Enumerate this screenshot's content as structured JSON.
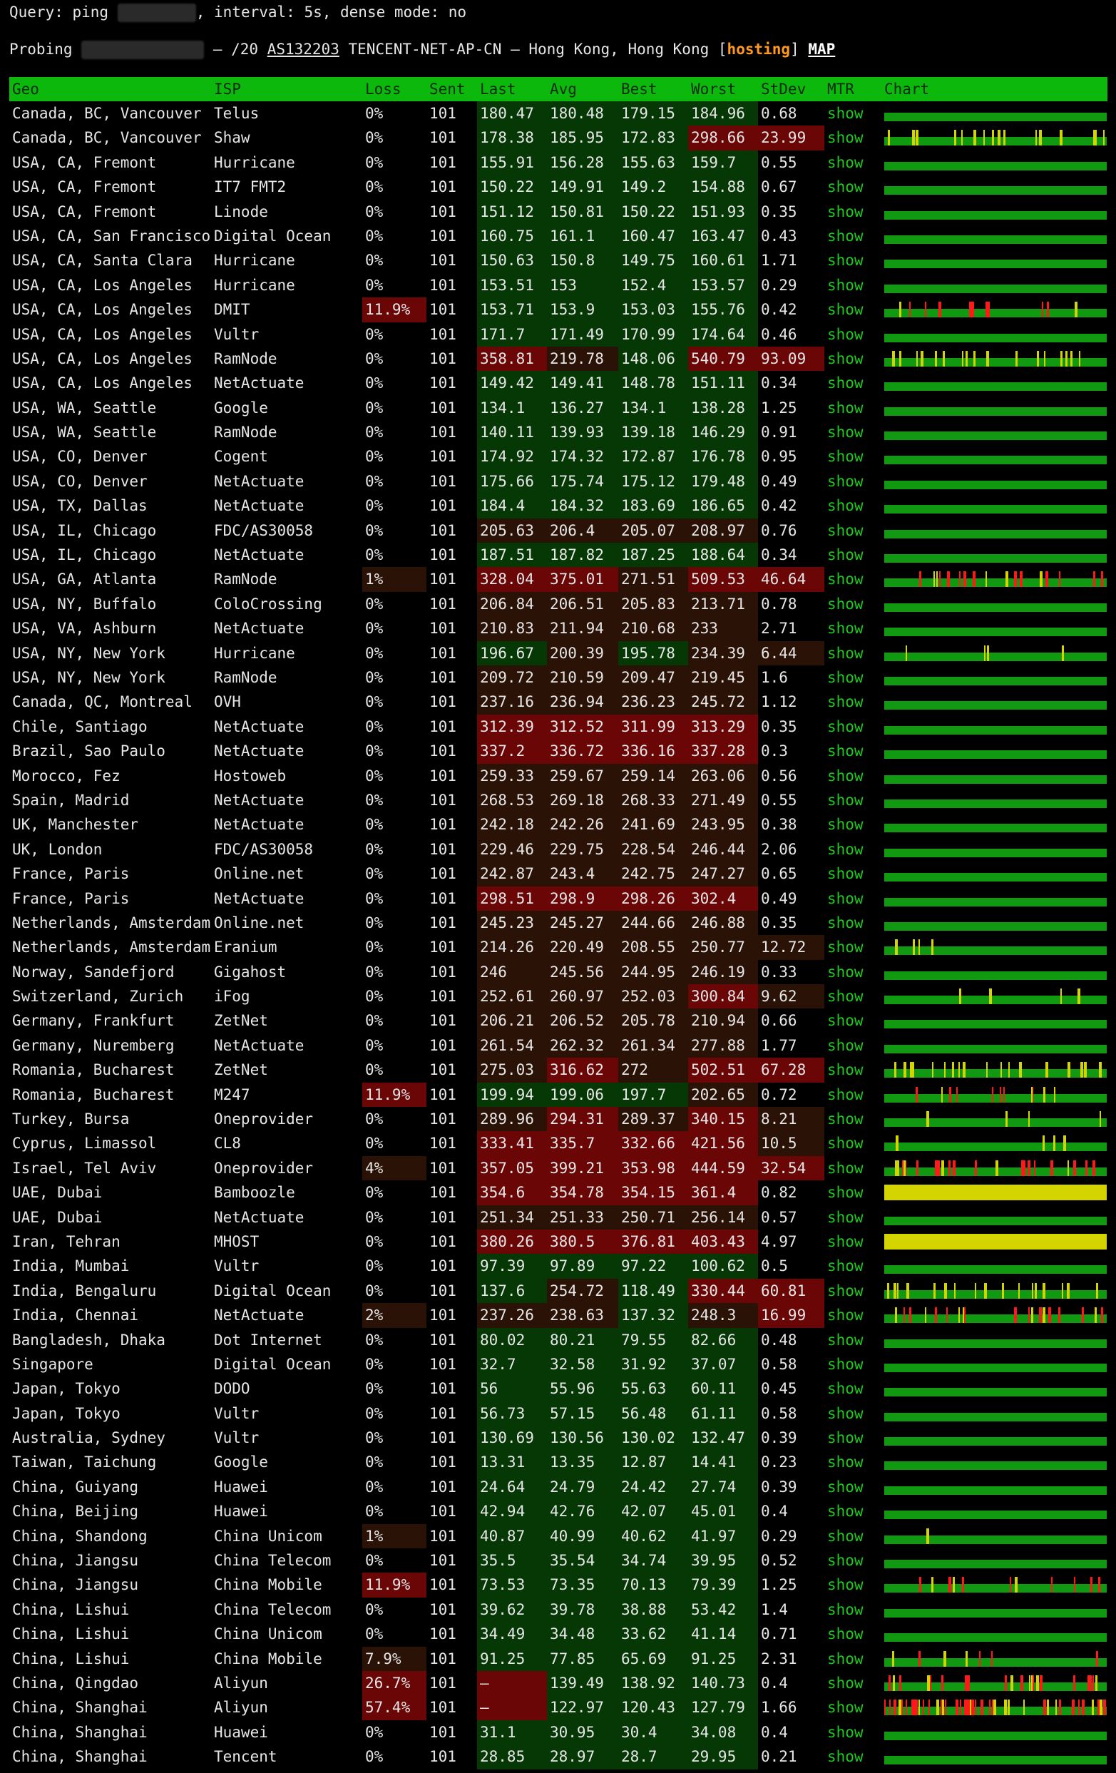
{
  "header": {
    "query_prefix": "Query: ping",
    "query_suffix": ", interval: 5s, dense mode: no",
    "probing_label": "Probing",
    "prefix": "– /20",
    "asn": "AS132203",
    "as_name": "TENCENT-NET-AP-CN – Hong Kong, Hong Kong",
    "tag": "hosting",
    "map_link": "MAP"
  },
  "columns": [
    "Geo",
    "ISP",
    "Loss",
    "Sent",
    "Last",
    "Avg",
    "Best",
    "Worst",
    "StDev",
    "MTR",
    "Chart"
  ],
  "mtr_label": "show",
  "colors": {
    "header_bg": "#0bb80b",
    "good": "#063806",
    "warn": "#2a1206",
    "bad": "#6a0606",
    "chart_base": "#119a11",
    "chart_spike_red": "#ff1a1a",
    "chart_spike_yellow": "#d4d400"
  },
  "rows": [
    [
      "Canada, BC, Vancouver",
      "Telus",
      "0%",
      "101",
      "180.47",
      "180.48",
      "179.15",
      "184.96",
      "0.68"
    ],
    [
      "Canada, BC, Vancouver",
      "Shaw",
      "0%",
      "101",
      "178.38",
      "185.95",
      "172.83",
      "298.66",
      "23.99"
    ],
    [
      "USA, CA, Fremont",
      "Hurricane",
      "0%",
      "101",
      "155.91",
      "156.28",
      "155.63",
      "159.7",
      "0.55"
    ],
    [
      "USA, CA, Fremont",
      "IT7 FMT2",
      "0%",
      "101",
      "150.22",
      "149.91",
      "149.2",
      "154.88",
      "0.67"
    ],
    [
      "USA, CA, Fremont",
      "Linode",
      "0%",
      "101",
      "151.12",
      "150.81",
      "150.22",
      "151.93",
      "0.35"
    ],
    [
      "USA, CA, San Francisco",
      "Digital Ocean",
      "0%",
      "101",
      "160.75",
      "161.1",
      "160.47",
      "163.47",
      "0.43"
    ],
    [
      "USA, CA, Santa Clara",
      "Hurricane",
      "0%",
      "101",
      "150.63",
      "150.8",
      "149.75",
      "160.61",
      "1.71"
    ],
    [
      "USA, CA, Los Angeles",
      "Hurricane",
      "0%",
      "101",
      "153.51",
      "153",
      "152.4",
      "153.57",
      "0.29"
    ],
    [
      "USA, CA, Los Angeles",
      "DMIT",
      "11.9%",
      "101",
      "153.71",
      "153.9",
      "153.03",
      "155.76",
      "0.42"
    ],
    [
      "USA, CA, Los Angeles",
      "Vultr",
      "0%",
      "101",
      "171.7",
      "171.49",
      "170.99",
      "174.64",
      "0.46"
    ],
    [
      "USA, CA, Los Angeles",
      "RamNode",
      "0%",
      "101",
      "358.81",
      "219.78",
      "148.06",
      "540.79",
      "93.09"
    ],
    [
      "USA, CA, Los Angeles",
      "NetActuate",
      "0%",
      "101",
      "149.42",
      "149.41",
      "148.78",
      "151.11",
      "0.34"
    ],
    [
      "USA, WA, Seattle",
      "Google",
      "0%",
      "101",
      "134.1",
      "136.27",
      "134.1",
      "138.28",
      "1.25"
    ],
    [
      "USA, WA, Seattle",
      "RamNode",
      "0%",
      "101",
      "140.11",
      "139.93",
      "139.18",
      "146.29",
      "0.91"
    ],
    [
      "USA, CO, Denver",
      "Cogent",
      "0%",
      "101",
      "174.92",
      "174.32",
      "172.87",
      "176.78",
      "0.95"
    ],
    [
      "USA, CO, Denver",
      "NetActuate",
      "0%",
      "101",
      "175.66",
      "175.74",
      "175.12",
      "179.48",
      "0.49"
    ],
    [
      "USA, TX, Dallas",
      "NetActuate",
      "0%",
      "101",
      "184.4",
      "184.32",
      "183.69",
      "186.65",
      "0.42"
    ],
    [
      "USA, IL, Chicago",
      "FDC/AS30058",
      "0%",
      "101",
      "205.63",
      "206.4",
      "205.07",
      "208.97",
      "0.76"
    ],
    [
      "USA, IL, Chicago",
      "NetActuate",
      "0%",
      "101",
      "187.51",
      "187.82",
      "187.25",
      "188.64",
      "0.34"
    ],
    [
      "USA, GA, Atlanta",
      "RamNode",
      "1%",
      "101",
      "328.04",
      "375.01",
      "271.51",
      "509.53",
      "46.64"
    ],
    [
      "USA, NY, Buffalo",
      "ColoCrossing",
      "0%",
      "101",
      "206.84",
      "206.51",
      "205.83",
      "213.71",
      "0.78"
    ],
    [
      "USA, VA, Ashburn",
      "NetActuate",
      "0%",
      "101",
      "210.83",
      "211.94",
      "210.68",
      "233",
      "2.71"
    ],
    [
      "USA, NY, New York",
      "Hurricane",
      "0%",
      "101",
      "196.67",
      "200.39",
      "195.78",
      "234.39",
      "6.44"
    ],
    [
      "USA, NY, New York",
      "RamNode",
      "0%",
      "101",
      "209.72",
      "210.59",
      "209.47",
      "219.45",
      "1.6"
    ],
    [
      "Canada, QC, Montreal",
      "OVH",
      "0%",
      "101",
      "237.16",
      "236.94",
      "236.23",
      "245.72",
      "1.12"
    ],
    [
      "Chile, Santiago",
      "NetActuate",
      "0%",
      "101",
      "312.39",
      "312.52",
      "311.99",
      "313.29",
      "0.35"
    ],
    [
      "Brazil, Sao Paulo",
      "NetActuate",
      "0%",
      "101",
      "337.2",
      "336.72",
      "336.16",
      "337.28",
      "0.3"
    ],
    [
      "Morocco, Fez",
      "Hostoweb",
      "0%",
      "101",
      "259.33",
      "259.67",
      "259.14",
      "263.06",
      "0.56"
    ],
    [
      "Spain, Madrid",
      "NetActuate",
      "0%",
      "101",
      "268.53",
      "269.18",
      "268.33",
      "271.49",
      "0.55"
    ],
    [
      "UK, Manchester",
      "NetActuate",
      "0%",
      "101",
      "242.18",
      "242.26",
      "241.69",
      "243.95",
      "0.38"
    ],
    [
      "UK, London",
      "FDC/AS30058",
      "0%",
      "101",
      "229.46",
      "229.75",
      "228.54",
      "246.44",
      "2.06"
    ],
    [
      "France, Paris",
      "Online.net",
      "0%",
      "101",
      "242.87",
      "243.4",
      "242.75",
      "247.27",
      "0.65"
    ],
    [
      "France, Paris",
      "NetActuate",
      "0%",
      "101",
      "298.51",
      "298.9",
      "298.26",
      "302.4",
      "0.49"
    ],
    [
      "Netherlands, Amsterdam",
      "Online.net",
      "0%",
      "101",
      "245.23",
      "245.27",
      "244.66",
      "246.88",
      "0.35"
    ],
    [
      "Netherlands, Amsterdam",
      "Eranium",
      "0%",
      "101",
      "214.26",
      "220.49",
      "208.55",
      "250.77",
      "12.72"
    ],
    [
      "Norway, Sandefjord",
      "Gigahost",
      "0%",
      "101",
      "246",
      "245.56",
      "244.95",
      "246.19",
      "0.33"
    ],
    [
      "Switzerland, Zurich",
      "iFog",
      "0%",
      "101",
      "252.61",
      "260.97",
      "252.03",
      "300.84",
      "9.62"
    ],
    [
      "Germany, Frankfurt",
      "ZetNet",
      "0%",
      "101",
      "206.21",
      "206.52",
      "205.78",
      "210.94",
      "0.66"
    ],
    [
      "Germany, Nuremberg",
      "NetActuate",
      "0%",
      "101",
      "261.54",
      "262.32",
      "261.34",
      "277.88",
      "1.77"
    ],
    [
      "Romania, Bucharest",
      "ZetNet",
      "0%",
      "101",
      "275.03",
      "316.62",
      "272",
      "502.51",
      "67.28"
    ],
    [
      "Romania, Bucharest",
      "M247",
      "11.9%",
      "101",
      "199.94",
      "199.06",
      "197.7",
      "202.65",
      "0.72"
    ],
    [
      "Turkey, Bursa",
      "Oneprovider",
      "0%",
      "101",
      "289.96",
      "294.31",
      "289.37",
      "340.15",
      "8.21"
    ],
    [
      "Cyprus, Limassol",
      "CL8",
      "0%",
      "101",
      "333.41",
      "335.7",
      "332.66",
      "421.56",
      "10.5"
    ],
    [
      "Israel, Tel Aviv",
      "Oneprovider",
      "4%",
      "101",
      "357.05",
      "399.21",
      "353.98",
      "444.59",
      "32.54"
    ],
    [
      "UAE, Dubai",
      "Bamboozle",
      "0%",
      "101",
      "354.6",
      "354.78",
      "354.15",
      "361.4",
      "0.82"
    ],
    [
      "UAE, Dubai",
      "NetActuate",
      "0%",
      "101",
      "251.34",
      "251.33",
      "250.71",
      "256.14",
      "0.57"
    ],
    [
      "Iran, Tehran",
      "MHOST",
      "0%",
      "101",
      "380.26",
      "380.5",
      "376.81",
      "403.43",
      "4.97"
    ],
    [
      "India, Mumbai",
      "Vultr",
      "0%",
      "101",
      "97.39",
      "97.89",
      "97.22",
      "100.62",
      "0.5"
    ],
    [
      "India, Bengaluru",
      "Digital Ocean",
      "0%",
      "101",
      "137.6",
      "254.72",
      "118.49",
      "330.44",
      "60.81"
    ],
    [
      "India, Chennai",
      "NetActuate",
      "2%",
      "101",
      "237.26",
      "238.63",
      "137.32",
      "248.3",
      "16.99"
    ],
    [
      "Bangladesh, Dhaka",
      "Dot Internet",
      "0%",
      "101",
      "80.02",
      "80.21",
      "79.55",
      "82.66",
      "0.48"
    ],
    [
      "Singapore",
      "Digital Ocean",
      "0%",
      "101",
      "32.7",
      "32.58",
      "31.92",
      "37.07",
      "0.58"
    ],
    [
      "Japan, Tokyo",
      "DODO",
      "0%",
      "101",
      "56",
      "55.96",
      "55.63",
      "60.11",
      "0.45"
    ],
    [
      "Japan, Tokyo",
      "Vultr",
      "0%",
      "101",
      "56.73",
      "57.15",
      "56.48",
      "61.11",
      "0.58"
    ],
    [
      "Australia, Sydney",
      "Vultr",
      "0%",
      "101",
      "130.69",
      "130.56",
      "130.02",
      "132.47",
      "0.39"
    ],
    [
      "Taiwan, Taichung",
      "Google",
      "0%",
      "101",
      "13.31",
      "13.35",
      "12.87",
      "14.41",
      "0.23"
    ],
    [
      "China, Guiyang",
      "Huawei",
      "0%",
      "101",
      "24.64",
      "24.79",
      "24.42",
      "27.74",
      "0.39"
    ],
    [
      "China, Beijing",
      "Huawei",
      "0%",
      "101",
      "42.94",
      "42.76",
      "42.07",
      "45.01",
      "0.4"
    ],
    [
      "China, Shandong",
      "China Unicom",
      "1%",
      "101",
      "40.87",
      "40.99",
      "40.62",
      "41.97",
      "0.29"
    ],
    [
      "China, Jiangsu",
      "China Telecom",
      "0%",
      "101",
      "35.5",
      "35.54",
      "34.74",
      "39.95",
      "0.52"
    ],
    [
      "China, Jiangsu",
      "China Mobile",
      "11.9%",
      "101",
      "73.53",
      "73.35",
      "70.13",
      "79.39",
      "1.25"
    ],
    [
      "China, Lishui",
      "China Telecom",
      "0%",
      "101",
      "39.62",
      "39.78",
      "38.88",
      "53.42",
      "1.4"
    ],
    [
      "China, Lishui",
      "China Unicom",
      "0%",
      "101",
      "34.49",
      "34.48",
      "33.62",
      "41.14",
      "0.71"
    ],
    [
      "China, Lishui",
      "China Mobile",
      "7.9%",
      "101",
      "91.25",
      "77.85",
      "65.69",
      "91.25",
      "2.31"
    ],
    [
      "China, Qingdao",
      "Aliyun",
      "26.7%",
      "101",
      "–",
      "139.49",
      "138.92",
      "140.73",
      "0.4"
    ],
    [
      "China, Shanghai",
      "Aliyun",
      "57.4%",
      "101",
      "–",
      "122.97",
      "120.43",
      "127.79",
      "1.66"
    ],
    [
      "China, Shanghai",
      "Huawei",
      "0%",
      "101",
      "31.1",
      "30.95",
      "30.4",
      "34.08",
      "0.4"
    ],
    [
      "China, Shanghai",
      "Tencent",
      "0%",
      "101",
      "28.85",
      "28.97",
      "28.7",
      "29.95",
      "0.21"
    ]
  ]
}
